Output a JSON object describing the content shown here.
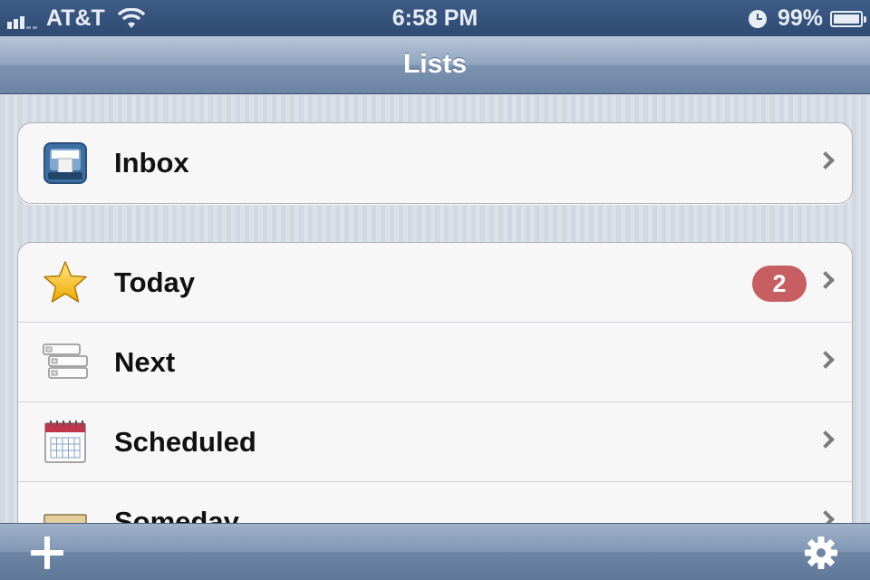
{
  "status_bar": {
    "carrier": "AT&T",
    "time": "6:58 PM",
    "battery_percent": "99%",
    "icons": [
      "signal-icon",
      "wifi-icon",
      "alarm-clock-icon",
      "battery-icon"
    ]
  },
  "nav": {
    "title": "Lists"
  },
  "inbox": {
    "label": "Inbox",
    "icon": "inbox-tray-icon"
  },
  "lists": [
    {
      "label": "Today",
      "icon": "star-icon",
      "badge": "2"
    },
    {
      "label": "Next",
      "icon": "stacked-cards-icon"
    },
    {
      "label": "Scheduled",
      "icon": "calendar-icon"
    },
    {
      "label": "Someday",
      "icon": "archive-box-icon"
    }
  ],
  "toolbar": {
    "add_icon": "plus-icon",
    "settings_icon": "gear-icon"
  },
  "colors": {
    "badge": "#c75f62",
    "nav_bar": "#8fa4bf",
    "status_bar": "#3d5c87"
  }
}
